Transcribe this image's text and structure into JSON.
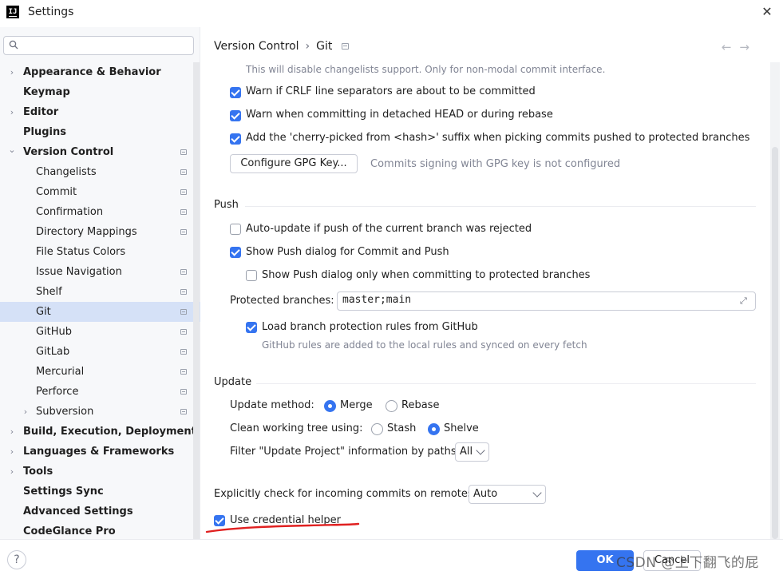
{
  "window": {
    "title": "Settings",
    "logo_text": "IJ"
  },
  "search": {
    "placeholder": ""
  },
  "sidebar": {
    "items": [
      {
        "label": "Appearance & Behavior",
        "level": 0,
        "expandable": true,
        "expanded": false,
        "project": false
      },
      {
        "label": "Keymap",
        "level": 0,
        "expandable": false,
        "project": false
      },
      {
        "label": "Editor",
        "level": 0,
        "expandable": true,
        "expanded": false,
        "project": false
      },
      {
        "label": "Plugins",
        "level": 0,
        "expandable": false,
        "project": false
      },
      {
        "label": "Version Control",
        "level": 0,
        "expandable": true,
        "expanded": true,
        "project": true
      },
      {
        "label": "Changelists",
        "level": 1,
        "project": true
      },
      {
        "label": "Commit",
        "level": 1,
        "project": true
      },
      {
        "label": "Confirmation",
        "level": 1,
        "project": true
      },
      {
        "label": "Directory Mappings",
        "level": 1,
        "project": true
      },
      {
        "label": "File Status Colors",
        "level": 1,
        "project": false
      },
      {
        "label": "Issue Navigation",
        "level": 1,
        "project": true
      },
      {
        "label": "Shelf",
        "level": 1,
        "project": true
      },
      {
        "label": "Git",
        "level": 1,
        "project": true,
        "selected": true
      },
      {
        "label": "GitHub",
        "level": 1,
        "project": true
      },
      {
        "label": "GitLab",
        "level": 1,
        "project": true
      },
      {
        "label": "Mercurial",
        "level": 1,
        "project": true
      },
      {
        "label": "Perforce",
        "level": 1,
        "project": true
      },
      {
        "label": "Subversion",
        "level": 1,
        "expandable": true,
        "expanded": false,
        "project": true
      },
      {
        "label": "Build, Execution, Deployment",
        "level": 0,
        "expandable": true,
        "expanded": false,
        "project": false
      },
      {
        "label": "Languages & Frameworks",
        "level": 0,
        "expandable": true,
        "expanded": false,
        "project": false
      },
      {
        "label": "Tools",
        "level": 0,
        "expandable": true,
        "expanded": false,
        "project": false
      },
      {
        "label": "Settings Sync",
        "level": 0,
        "expandable": false,
        "project": false
      },
      {
        "label": "Advanced Settings",
        "level": 0,
        "expandable": false,
        "project": false
      },
      {
        "label": "CodeGlance Pro",
        "level": 0,
        "expandable": false,
        "project": false
      }
    ]
  },
  "breadcrumb": {
    "parent": "Version Control",
    "separator": "›",
    "current": "Git"
  },
  "nav": {
    "back": "←",
    "forward": "→"
  },
  "content": {
    "changelists_hint": "This will disable changelists support. Only for non-modal commit interface.",
    "crlf_warning": {
      "label": "Warn if CRLF line separators are about to be committed",
      "checked": true
    },
    "detached_head_warning": {
      "label": "Warn when committing in detached HEAD or during rebase",
      "checked": true
    },
    "cherry_pick_suffix": {
      "label": "Add the 'cherry-picked from <hash>' suffix when picking commits pushed to protected branches",
      "checked": true
    },
    "gpg_button": "Configure GPG Key...",
    "gpg_hint": "Commits signing with GPG key is not configured",
    "push": {
      "title": "Push",
      "auto_update": {
        "label": "Auto-update if push of the current branch was rejected",
        "checked": false
      },
      "show_push_dialog": {
        "label": "Show Push dialog for Commit and Push",
        "checked": true
      },
      "show_push_protected": {
        "label": "Show Push dialog only when committing to protected branches",
        "checked": false
      },
      "protected_label": "Protected branches:",
      "protected_value": "master;main",
      "load_rules": {
        "label": "Load branch protection rules from GitHub",
        "checked": true
      },
      "rules_hint": "GitHub rules are added to the local rules and synced on every fetch"
    },
    "update": {
      "title": "Update",
      "method_label": "Update method:",
      "method_merge": "Merge",
      "method_rebase": "Rebase",
      "method_selected": "Merge",
      "clean_label": "Clean working tree using:",
      "clean_stash": "Stash",
      "clean_shelve": "Shelve",
      "clean_selected": "Shelve",
      "filter_label": "Filter \"Update Project\" information by paths:",
      "filter_value": "All"
    },
    "incoming_label": "Explicitly check for incoming commits on remotes:",
    "incoming_value": "Auto",
    "credential_helper": {
      "label": "Use credential helper",
      "checked": true
    }
  },
  "footer": {
    "help": "?",
    "ok": "OK",
    "cancel": "Cancel"
  },
  "watermark": "CSDN @上下翻飞的屁",
  "colors": {
    "accent": "#3574f0",
    "selection": "#d5e1f7",
    "annotation": "#e02020"
  }
}
